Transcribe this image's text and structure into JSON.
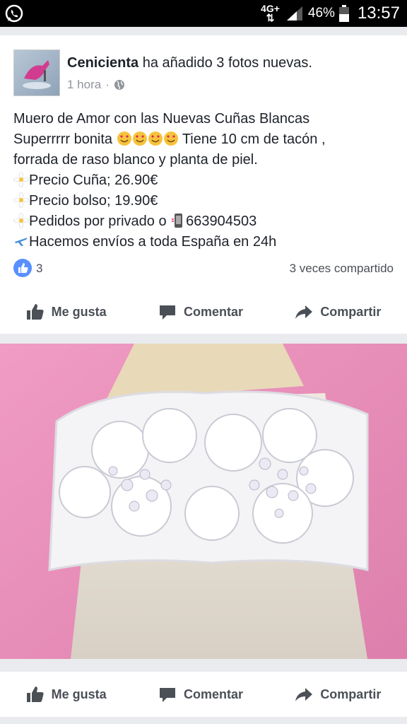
{
  "status": {
    "network": "4G+",
    "network_arrows": "⇅",
    "battery_pct": "46%",
    "time": "13:57"
  },
  "post": {
    "author": "Cenicienta",
    "action": "ha añadido 3 fotos nuevas.",
    "time": "1 hora",
    "separator": "·",
    "line1": "Muero de Amor con las Nuevas Cuñas Blancas",
    "line2_a": "Superrrrr bonita",
    "line2_b": "Tiene 10 cm de tacón ,",
    "line3": "forrada de raso blanco y planta de piel.",
    "line4": "Precio Cuña; 26.90€",
    "line5": "Precio bolso; 19.90€",
    "line6": "Pedidos por privado o",
    "phone": "663904503",
    "line7": "Hacemos envíos a toda España en 24h",
    "like_count": "3",
    "shares": "3 veces compartido"
  },
  "actions": {
    "like": "Me gusta",
    "comment": "Comentar",
    "share": "Compartir"
  },
  "colors": {
    "accent": "#5890ff",
    "photo_background": "#e68ab3"
  }
}
